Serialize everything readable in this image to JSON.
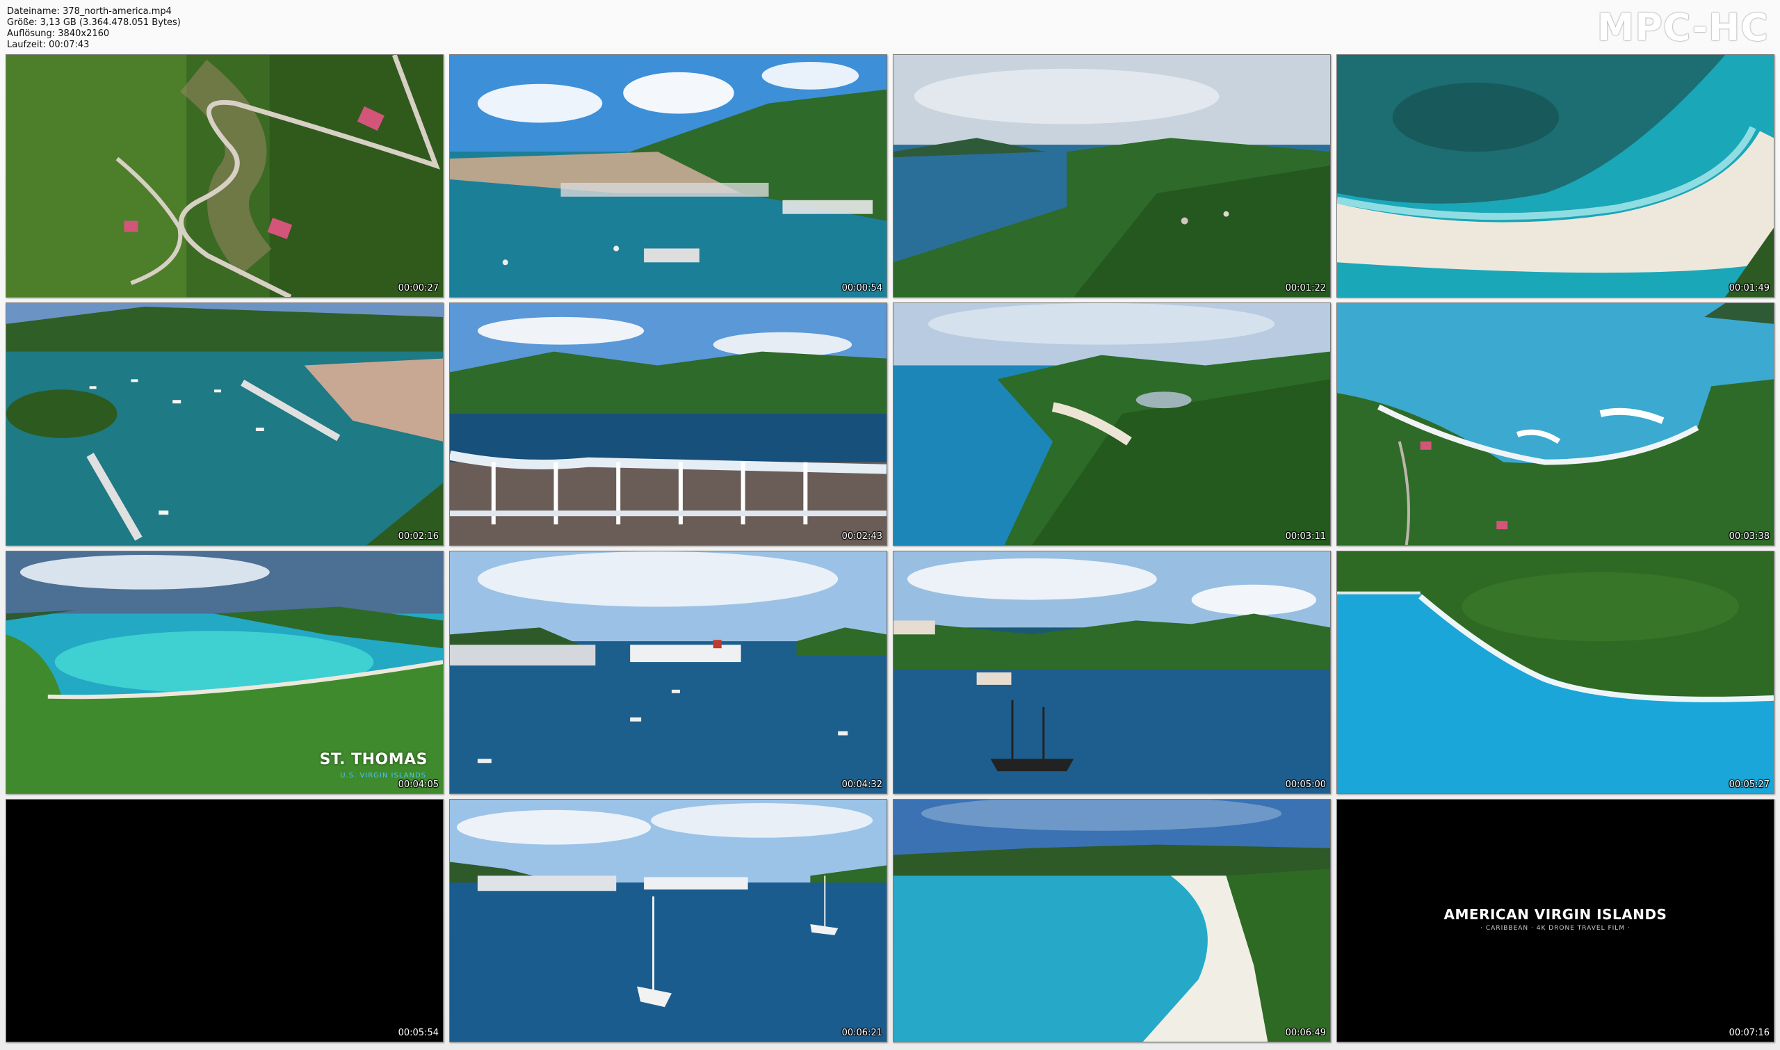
{
  "file_info": {
    "name_line": "Dateiname: 378_north-america.mp4",
    "size_line": "Größe: 3,13 GB (3.364.478.051 Bytes)",
    "resolution_line": "Auflösung: 3840x2160",
    "duration_line": "Laufzeit: 00:07:43"
  },
  "logo": "MPC-HC",
  "thumbnails": [
    {
      "timestamp": "00:00:27"
    },
    {
      "timestamp": "00:00:54"
    },
    {
      "timestamp": "00:01:22"
    },
    {
      "timestamp": "00:01:49"
    },
    {
      "timestamp": "00:02:16"
    },
    {
      "timestamp": "00:02:43"
    },
    {
      "timestamp": "00:03:11"
    },
    {
      "timestamp": "00:03:38"
    },
    {
      "timestamp": "00:04:05",
      "caption": "ST. THOMAS",
      "subcaption": "U.S. VIRGIN ISLANDS"
    },
    {
      "timestamp": "00:04:32"
    },
    {
      "timestamp": "00:05:00"
    },
    {
      "timestamp": "00:05:27"
    },
    {
      "timestamp": "00:05:54"
    },
    {
      "timestamp": "00:06:21"
    },
    {
      "timestamp": "00:06:49"
    },
    {
      "timestamp": "00:07:16",
      "caption": "AMERICAN VIRGIN ISLANDS",
      "subcaption": "· CARIBBEAN · 4K DRONE TRAVEL FILM ·"
    }
  ]
}
